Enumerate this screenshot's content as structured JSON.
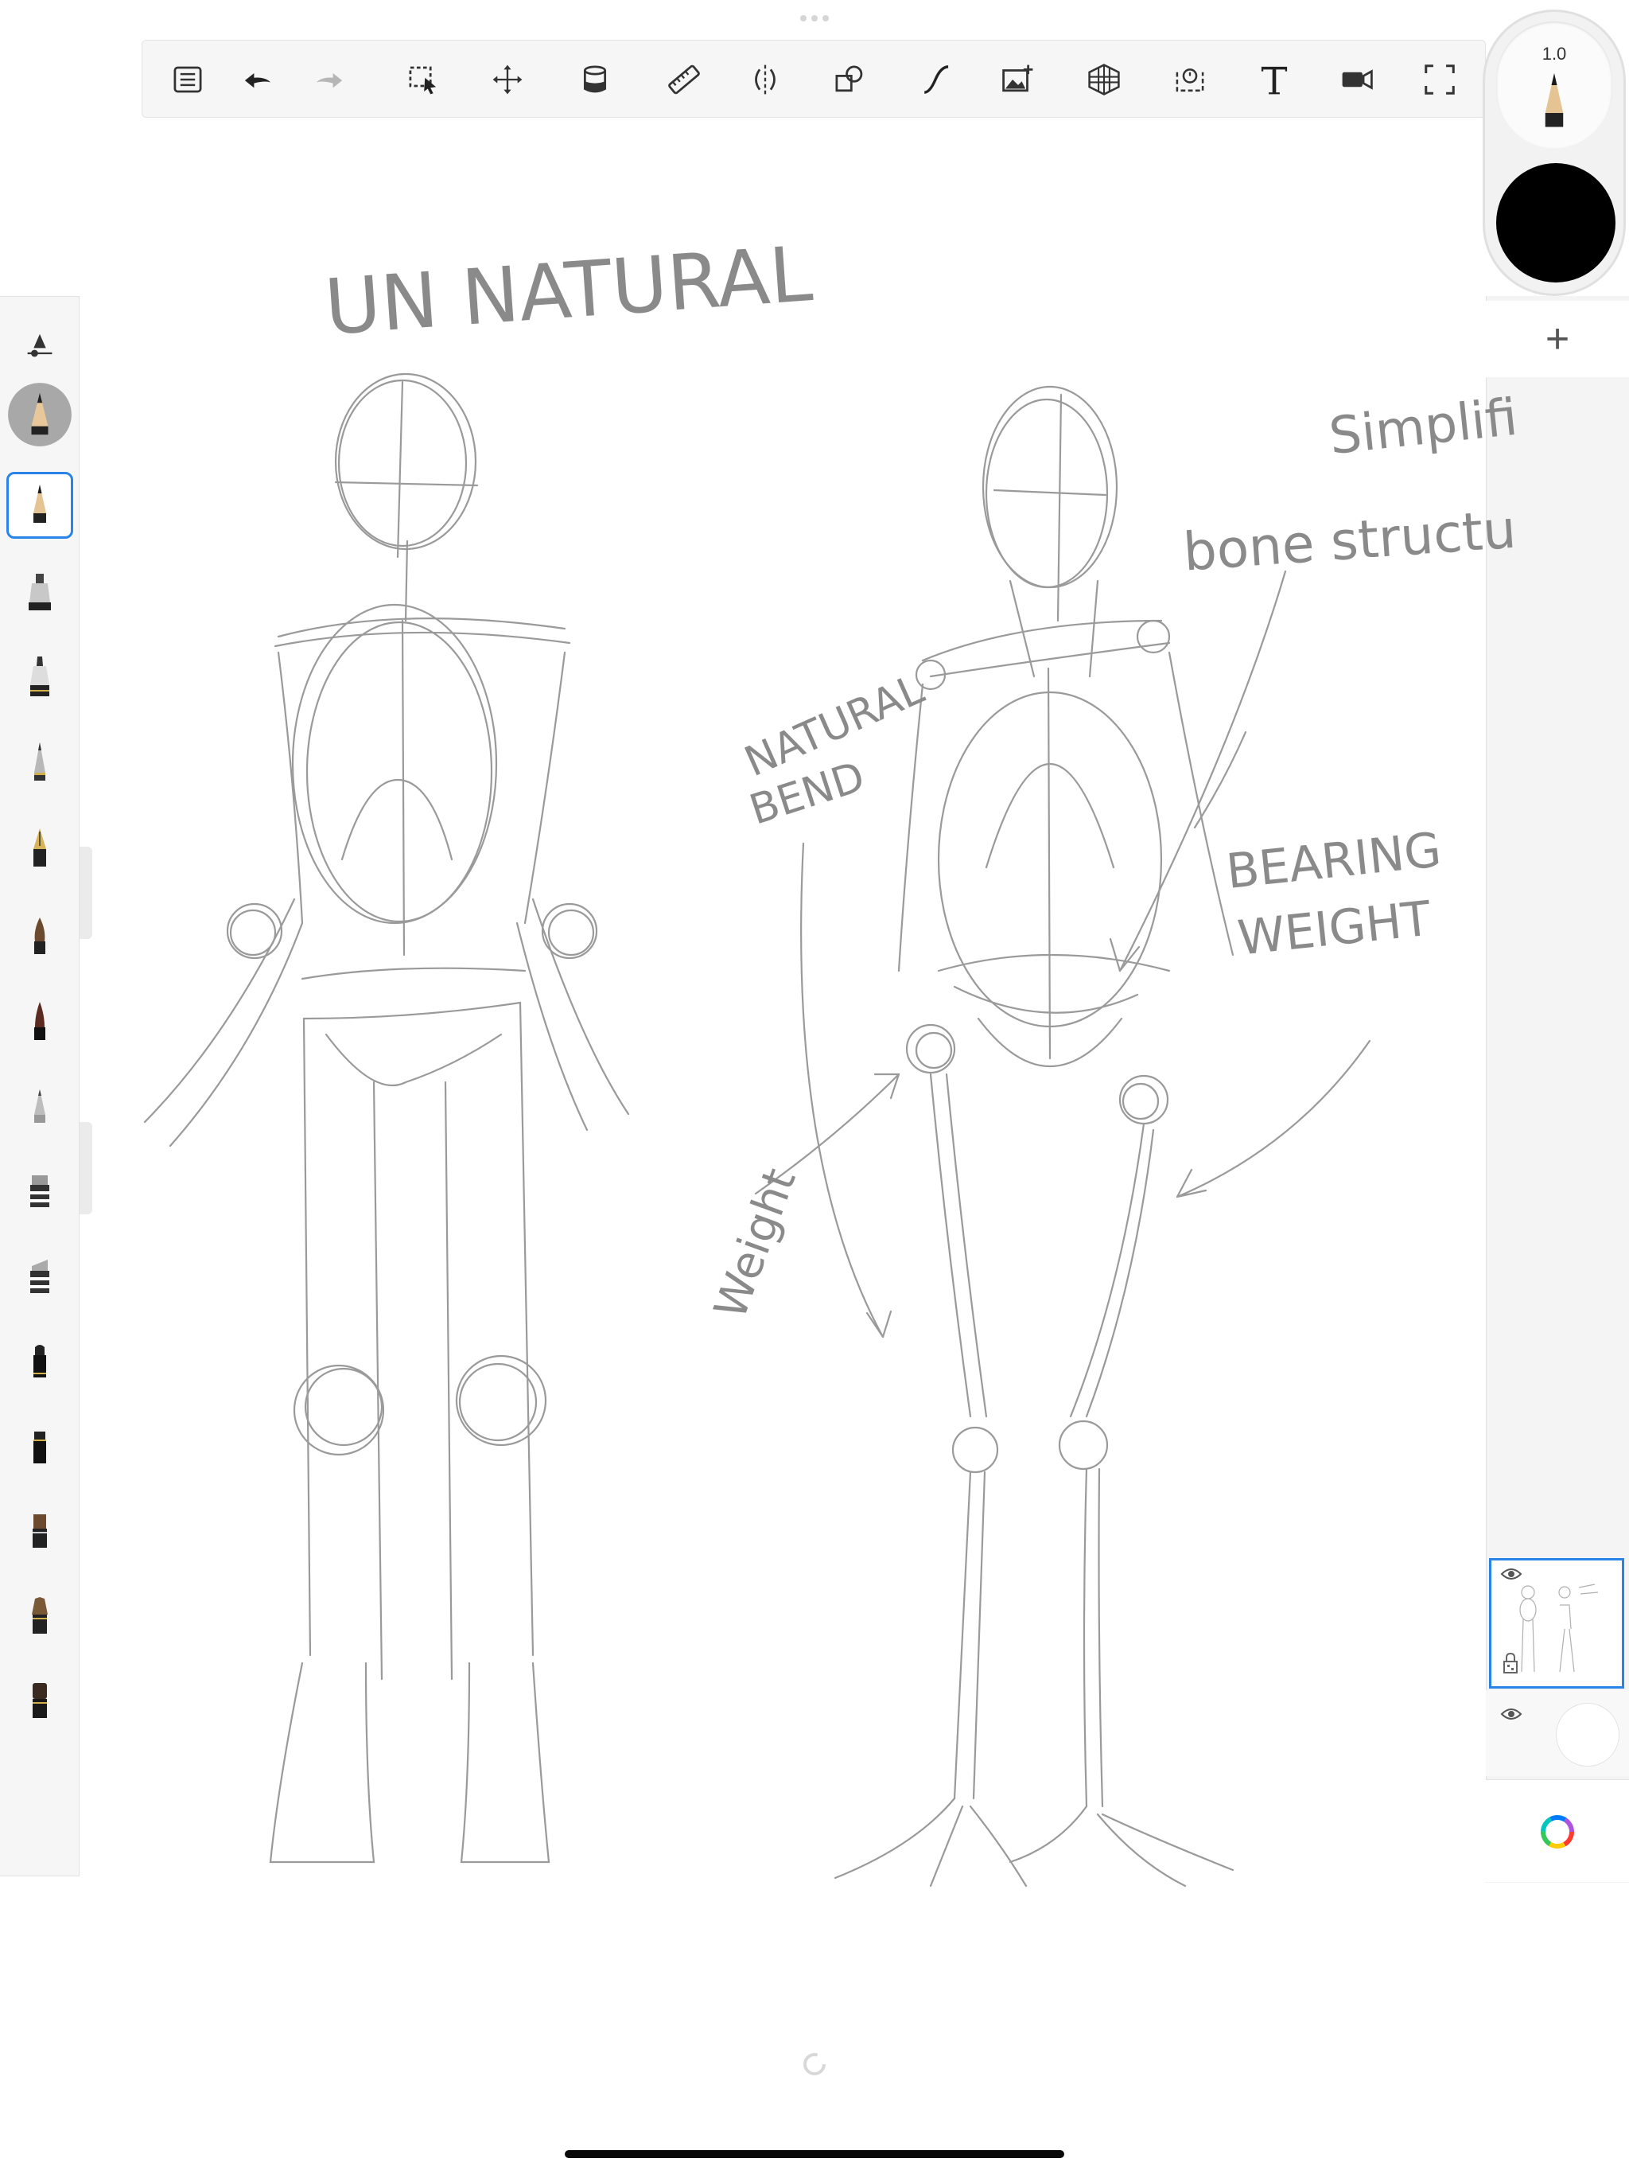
{
  "toolbar": {
    "items": [
      {
        "icon": "list-icon",
        "name": "Gallery / Menu"
      },
      {
        "icon": "undo-icon",
        "name": "Undo"
      },
      {
        "icon": "redo-icon",
        "name": "Redo"
      },
      {
        "icon": "select-icon",
        "name": "Selection"
      },
      {
        "icon": "transform-icon",
        "name": "Transform"
      },
      {
        "icon": "fill-icon",
        "name": "Fill"
      },
      {
        "icon": "ruler-icon",
        "name": "Ruler"
      },
      {
        "icon": "symmetry-icon",
        "name": "Symmetry"
      },
      {
        "icon": "shapes-icon",
        "name": "Shapes"
      },
      {
        "icon": "curve-icon",
        "name": "Stroke style"
      },
      {
        "icon": "add-image-icon",
        "name": "Import image"
      },
      {
        "icon": "perspective-icon",
        "name": "Perspective"
      },
      {
        "icon": "flipbook-icon",
        "name": "Flipbook"
      },
      {
        "icon": "text-icon",
        "name": "Text",
        "label": "T"
      },
      {
        "icon": "record-icon",
        "name": "Time-lapse"
      },
      {
        "icon": "fullscreen-icon",
        "name": "Full screen"
      }
    ]
  },
  "brush_panel": {
    "active_index": 0,
    "brushes": [
      "pencil",
      "marker",
      "ink-pen",
      "pencil-silver",
      "fountain-pen",
      "paint-brush",
      "brush-pen",
      "airbrush",
      "eraser",
      "soft-eraser",
      "marker-black",
      "marker-square",
      "brush-flat",
      "brush-fan",
      "brush-round"
    ]
  },
  "puck": {
    "size_label": "1.0",
    "color": "#000000"
  },
  "layers": {
    "add_label": "+",
    "items": [
      {
        "visible": true,
        "selected": true
      },
      {
        "visible": true,
        "selected": false
      }
    ]
  },
  "colors": {
    "accent": "#2a84e8",
    "panel": "#f6f6f6",
    "sketch": "#8a8a8a"
  },
  "sketch": {
    "title": "UN NATURAL",
    "note_simplified": [
      "Simplified",
      "bone structure"
    ],
    "note_natural": [
      "NATURAL",
      "BEND"
    ],
    "note_bearing": [
      "BEARING",
      "WEIGHT"
    ],
    "note_weight": "Weight"
  }
}
